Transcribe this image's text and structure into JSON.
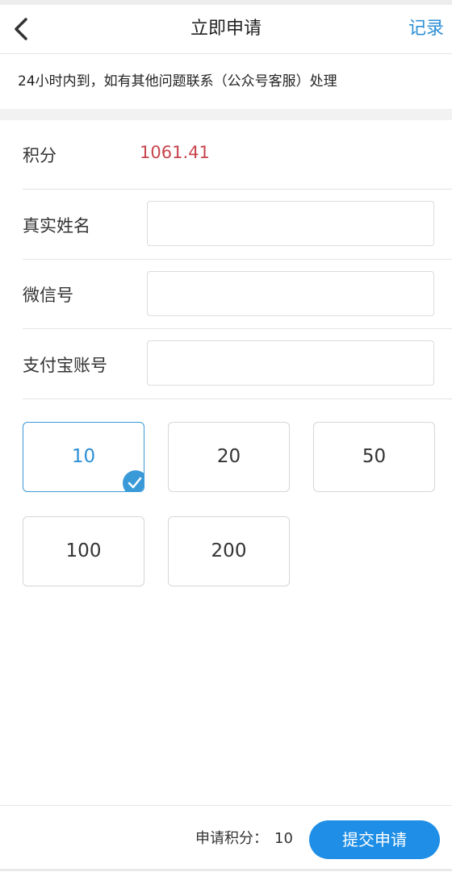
{
  "navbar": {
    "title": "立即申请",
    "record_label": "记录"
  },
  "notice": {
    "text": "24小时内到，如有其他问题联系（公众号客服）处理"
  },
  "form": {
    "points_label": "积分",
    "points_value": "1061.41",
    "real_name_label": "真实姓名",
    "real_name_value": "",
    "wechat_label": "微信号",
    "wechat_value": "",
    "alipay_label": "支付宝账号",
    "alipay_value": ""
  },
  "amounts": {
    "options": [
      "10",
      "20",
      "50",
      "100",
      "200"
    ],
    "selected": "10"
  },
  "footer": {
    "apply_points_label": "申请积分：",
    "apply_points_value": "10",
    "submit_label": "提交申请"
  },
  "colors": {
    "accent": "#1f8ee6",
    "points": "#c9444d",
    "selected_border": "#3a9ad8"
  },
  "icons": {
    "back": "chevron-left-icon",
    "check": "checkmark-icon"
  }
}
